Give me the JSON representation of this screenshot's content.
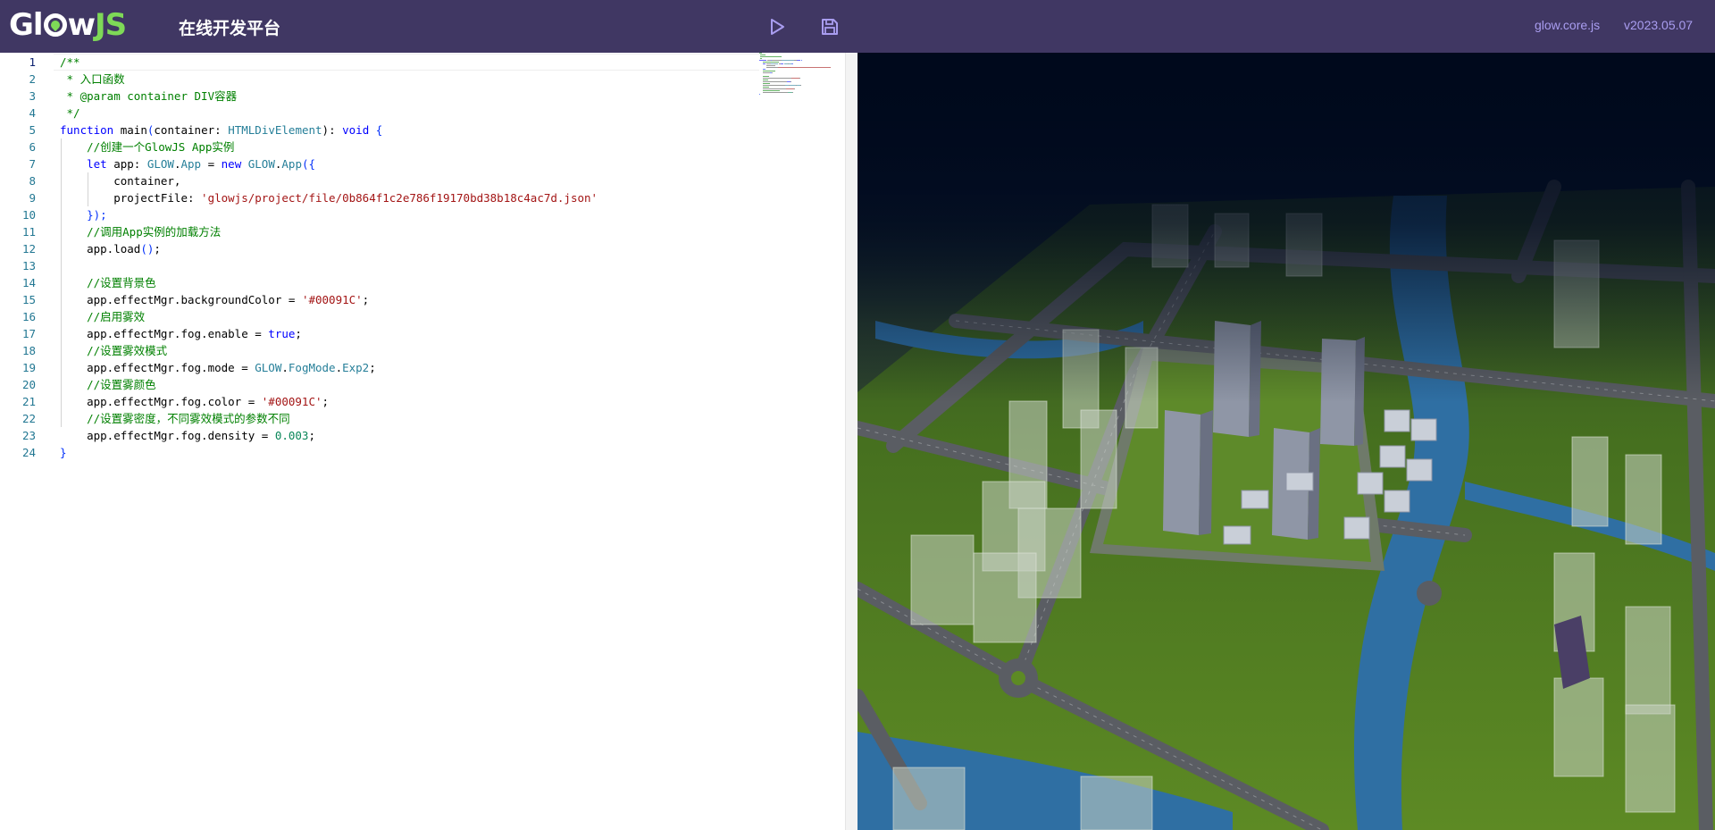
{
  "header": {
    "logo_text_a": "Gl",
    "logo_text_b": "w",
    "logo_text_c": "JS",
    "title": "在线开发平台",
    "run_icon": "play-icon",
    "save_icon": "save-icon",
    "core_link": "glow.core.js",
    "version": "v2023.05.07"
  },
  "editor": {
    "active_line": 1,
    "line_numbers": [
      "1",
      "2",
      "3",
      "4",
      "5",
      "6",
      "7",
      "8",
      "9",
      "10",
      "11",
      "12",
      "13",
      "14",
      "15",
      "16",
      "17",
      "18",
      "19",
      "20",
      "21",
      "22",
      "23",
      "24"
    ],
    "lines": [
      [
        {
          "t": "/**",
          "c": "cm"
        }
      ],
      [
        {
          "t": " * 入口函数",
          "c": "cm"
        }
      ],
      [
        {
          "t": " * @param container DIV容器",
          "c": "cm"
        }
      ],
      [
        {
          "t": " */",
          "c": "cm"
        }
      ],
      [
        {
          "t": "function",
          "c": "kw"
        },
        {
          "t": " main",
          "c": ""
        },
        {
          "t": "(",
          "c": "br"
        },
        {
          "t": "container: ",
          "c": ""
        },
        {
          "t": "HTMLDivElement",
          "c": "ty"
        },
        {
          "t": "): ",
          "c": ""
        },
        {
          "t": "void",
          "c": "kw"
        },
        {
          "t": " {",
          "c": "br"
        }
      ],
      [
        {
          "t": "    //创建一个GlowJS App实例",
          "c": "cm"
        }
      ],
      [
        {
          "t": "    ",
          "c": ""
        },
        {
          "t": "let",
          "c": "kw"
        },
        {
          "t": " app: ",
          "c": ""
        },
        {
          "t": "GLOW",
          "c": "ty"
        },
        {
          "t": ".",
          "c": ""
        },
        {
          "t": "App",
          "c": "ty"
        },
        {
          "t": " = ",
          "c": ""
        },
        {
          "t": "new",
          "c": "kw"
        },
        {
          "t": " ",
          "c": ""
        },
        {
          "t": "GLOW",
          "c": "ty"
        },
        {
          "t": ".",
          "c": ""
        },
        {
          "t": "App",
          "c": "ty"
        },
        {
          "t": "({",
          "c": "br"
        }
      ],
      [
        {
          "t": "        container,",
          "c": ""
        }
      ],
      [
        {
          "t": "        projectFile: ",
          "c": ""
        },
        {
          "t": "'glowjs/project/file/0b864f1c2e786f19170bd38b18c4ac7d.json'",
          "c": "st"
        }
      ],
      [
        {
          "t": "    ",
          "c": ""
        },
        {
          "t": "});",
          "c": "br"
        }
      ],
      [
        {
          "t": "    //调用App实例的加载方法",
          "c": "cm"
        }
      ],
      [
        {
          "t": "    app.load",
          "c": ""
        },
        {
          "t": "()",
          "c": "br"
        },
        {
          "t": ";",
          "c": ""
        }
      ],
      [
        {
          "t": "",
          "c": ""
        }
      ],
      [
        {
          "t": "    //设置背景色",
          "c": "cm"
        }
      ],
      [
        {
          "t": "    app.effectMgr.backgroundColor = ",
          "c": ""
        },
        {
          "t": "'#00091C'",
          "c": "st"
        },
        {
          "t": ";",
          "c": ""
        }
      ],
      [
        {
          "t": "    //启用雾效",
          "c": "cm"
        }
      ],
      [
        {
          "t": "    app.effectMgr.fog.enable = ",
          "c": ""
        },
        {
          "t": "true",
          "c": "kw"
        },
        {
          "t": ";",
          "c": ""
        }
      ],
      [
        {
          "t": "    //设置雾效模式",
          "c": "cm"
        }
      ],
      [
        {
          "t": "    app.effectMgr.fog.mode = ",
          "c": ""
        },
        {
          "t": "GLOW",
          "c": "ty"
        },
        {
          "t": ".",
          "c": ""
        },
        {
          "t": "FogMode",
          "c": "ty"
        },
        {
          "t": ".",
          "c": ""
        },
        {
          "t": "Exp2",
          "c": "ty"
        },
        {
          "t": ";",
          "c": ""
        }
      ],
      [
        {
          "t": "    //设置雾颜色",
          "c": "cm"
        }
      ],
      [
        {
          "t": "    app.effectMgr.fog.color = ",
          "c": ""
        },
        {
          "t": "'#00091C'",
          "c": "st"
        },
        {
          "t": ";",
          "c": ""
        }
      ],
      [
        {
          "t": "    //设置雾密度，不同雾效模式的参数不同",
          "c": "cm"
        }
      ],
      [
        {
          "t": "    app.effectMgr.fog.density = ",
          "c": ""
        },
        {
          "t": "0.003",
          "c": "nm"
        },
        {
          "t": ";",
          "c": ""
        }
      ],
      [
        {
          "t": "}",
          "c": "br"
        }
      ]
    ]
  },
  "colors": {
    "header_bg": "#403763",
    "accent_green": "#7ed957",
    "link_purple": "#a99df0",
    "scene_bg": "#00091C",
    "grass": "#4d7a22",
    "water": "#2f6fa3",
    "road": "#5a5d63"
  },
  "viewport": {
    "icon": "scene-3d-view"
  }
}
